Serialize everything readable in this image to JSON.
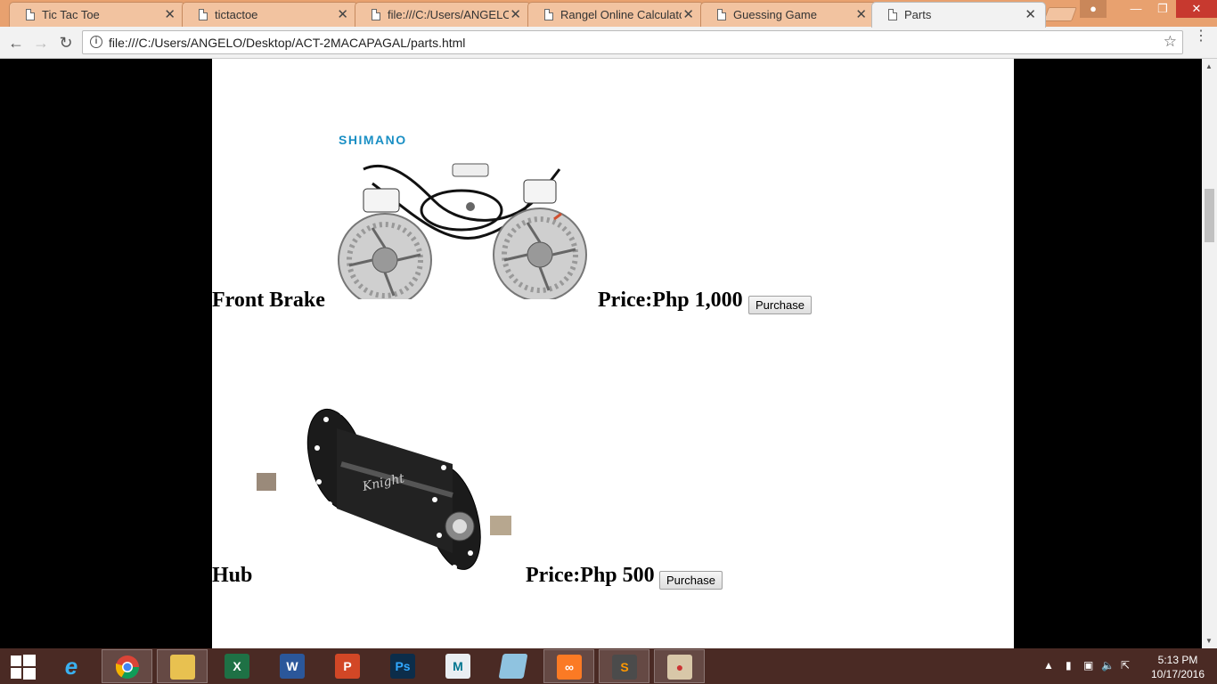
{
  "browser": {
    "tabs": [
      {
        "label": "Tic Tac Toe",
        "active": false
      },
      {
        "label": "tictactoe",
        "active": false
      },
      {
        "label": "file:///C:/Users/ANGELO/",
        "active": false
      },
      {
        "label": "Rangel Online Calculator",
        "active": false
      },
      {
        "label": "Guessing Game",
        "active": false
      },
      {
        "label": "Parts",
        "active": true
      }
    ],
    "url": "file:///C:/Users/ANGELO/Desktop/ACT-2MACAPAGAL/parts.html",
    "close_glyph": "✕"
  },
  "page": {
    "items": [
      {
        "name": "Front Brake",
        "price": "Price:Php 1,000",
        "button": "Purchase",
        "brand": "SHIMANO"
      },
      {
        "name": "Hub",
        "price": "Price:Php 500",
        "button": "Purchase",
        "engraving": "Knight"
      }
    ]
  },
  "taskbar": {
    "apps": [
      "start-icon",
      "internet-explorer-icon",
      "chrome-icon",
      "file-explorer-icon",
      "excel-icon",
      "word-icon",
      "powerpoint-icon",
      "photoshop-icon",
      "mysql-installer-icon",
      "notepad-icon",
      "xampp-icon",
      "sublime-text-icon",
      "paint-icon"
    ],
    "time": "5:13 PM",
    "date": "10/17/2016"
  }
}
